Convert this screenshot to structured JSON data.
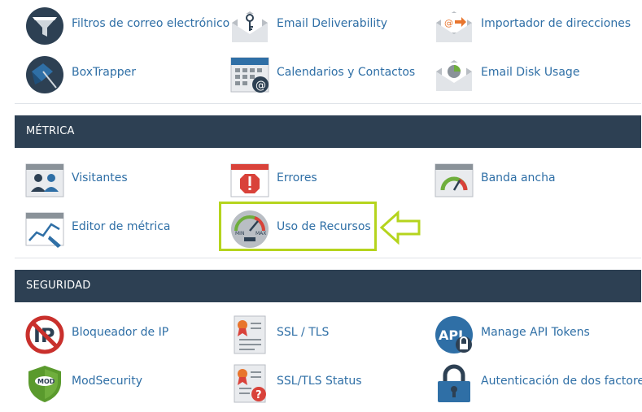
{
  "email": {
    "items": [
      {
        "label": "Filtros de correo electrónico",
        "icon": "funnel-icon"
      },
      {
        "label": "Email Deliverability",
        "icon": "envelope-key-icon"
      },
      {
        "label": "Importador de direcciones",
        "icon": "envelope-import-icon"
      },
      {
        "label": "BoxTrapper",
        "icon": "boxtrapper-icon"
      },
      {
        "label": "Calendarios y Contactos",
        "icon": "calendar-contacts-icon"
      },
      {
        "label": "Email Disk Usage",
        "icon": "envelope-pie-icon"
      }
    ]
  },
  "metrics": {
    "title": "MÉTRICA",
    "items": [
      {
        "label": "Visitantes",
        "icon": "visitors-icon"
      },
      {
        "label": "Errores",
        "icon": "errors-icon"
      },
      {
        "label": "Banda ancha",
        "icon": "bandwidth-gauge-icon"
      },
      {
        "label": "Editor de métrica",
        "icon": "metrics-editor-icon"
      },
      {
        "label": "Uso de Recursos",
        "icon": "resource-usage-gauge-icon"
      }
    ],
    "gauge_min_label": "MIN",
    "gauge_max_label": "MAX"
  },
  "security": {
    "title": "SEGURIDAD",
    "items": [
      {
        "label": "Bloqueador de IP",
        "icon": "ip-blocker-icon"
      },
      {
        "label": "SSL / TLS",
        "icon": "ssl-certificate-icon"
      },
      {
        "label": "Manage API Tokens",
        "icon": "api-token-icon"
      },
      {
        "label": "ModSecurity",
        "icon": "modsecurity-shield-icon"
      },
      {
        "label": "SSL/TLS Status",
        "icon": "ssl-status-icon"
      },
      {
        "label": "Autenticación de dos factores",
        "icon": "padlock-icon"
      }
    ],
    "ip_text": "IP",
    "api_text": "API",
    "mod_text": "MOD"
  },
  "colors": {
    "header_bg": "#2d4053",
    "link": "#2f6fa6",
    "highlight": "#b5d41d"
  }
}
